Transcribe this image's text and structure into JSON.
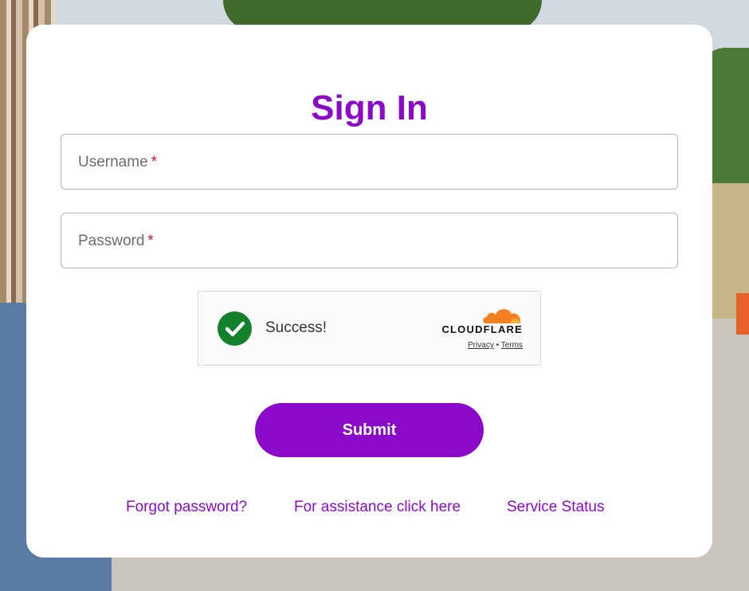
{
  "form": {
    "title": "Sign In",
    "username": {
      "label": "Username",
      "required_mark": "*"
    },
    "password": {
      "label": "Password",
      "required_mark": "*"
    },
    "submit_label": "Submit"
  },
  "captcha": {
    "status": "Success!",
    "provider": "CLOUDFLARE",
    "privacy_label": "Privacy",
    "separator": "•",
    "terms_label": "Terms",
    "status_color": "#11822a"
  },
  "links": {
    "forgot_password": "Forgot password?",
    "assistance": "For assistance click here",
    "service_status": "Service Status"
  },
  "colors": {
    "accent": "#8b0ac9",
    "required": "#d1122b",
    "cloudflare_orange": "#f38020"
  }
}
